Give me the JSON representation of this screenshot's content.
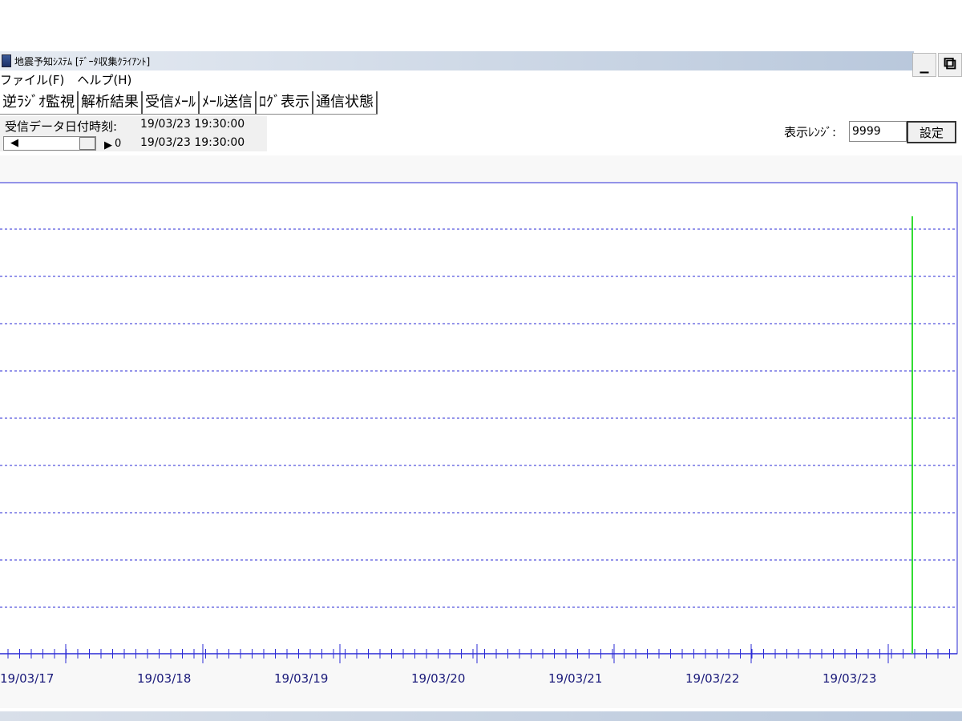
{
  "window": {
    "title": "地震予知ｼｽﾃﾑ [ﾃﾞｰﾀ収集ｸﾗｲｱﾝﾄ]",
    "minimize_label": "_",
    "restore_label": "⧉"
  },
  "menubar": {
    "items": [
      "ファイル(F)",
      "ヘルプ(H)"
    ]
  },
  "tabs": [
    "逆ﾗｼﾞｵ監視",
    "解析結果",
    "受信ﾒｰﾙ",
    "ﾒｰﾙ送信",
    "ﾛｸﾞ表示",
    "通信状態"
  ],
  "info": {
    "label": "受信データ日付時刻:",
    "time_1": "19/03/23 19:30:00",
    "time_2": "19/03/23 19:30:00",
    "scroll_value": "0"
  },
  "range": {
    "label": "表示ﾚﾝｼﾞ:",
    "value": "9999",
    "set_label": "設定"
  },
  "chart_data": {
    "type": "line",
    "x_labels": [
      "19/03/17",
      "19/03/18",
      "19/03/19",
      "19/03/20",
      "19/03/21",
      "19/03/22",
      "19/03/23"
    ],
    "grid": true,
    "series": [
      {
        "color": "#33dd33",
        "values": [
          {
            "x": "19/03/23 ~16:00",
            "y": 1.0
          }
        ]
      }
    ]
  },
  "colors": {
    "grid": "#2b2bd6",
    "axis": "#2b2bd6",
    "spike": "#33dd33",
    "frame": "#2b2bd6"
  }
}
